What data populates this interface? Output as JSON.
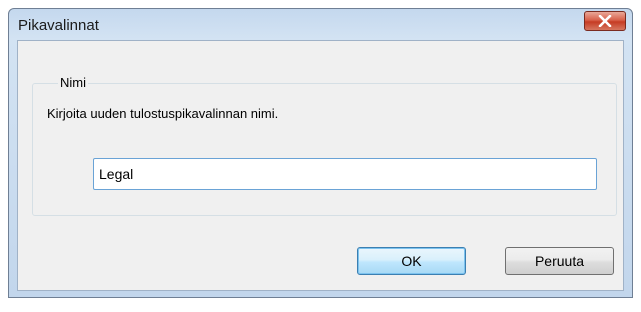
{
  "window": {
    "title": "Pikavalinnat",
    "close_icon": "close-x-icon"
  },
  "group": {
    "legend": "Nimi",
    "description": "Kirjoita uuden tulostuspikavalinnan nimi."
  },
  "name_field": {
    "value": "Legal"
  },
  "buttons": {
    "ok": "OK",
    "cancel": "Peruuta"
  },
  "colors": {
    "close_button": "#c63c24",
    "input_border": "#6aa3d6",
    "default_button_border": "#3c7fb1"
  }
}
